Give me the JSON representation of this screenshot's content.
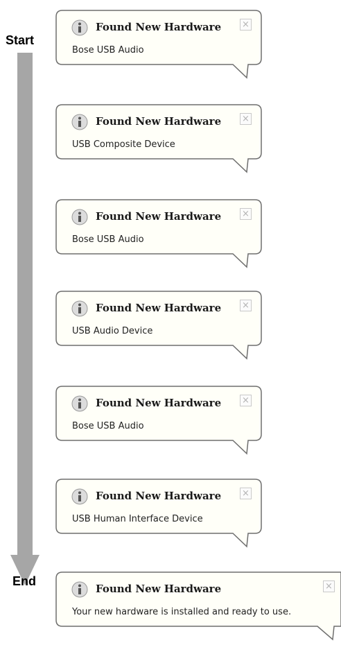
{
  "flow": {
    "start_label": "Start",
    "end_label": "End"
  },
  "notifications": [
    {
      "title": "Found New Hardware",
      "message": "Bose USB Audio",
      "close": "×"
    },
    {
      "title": "Found New Hardware",
      "message": "USB Composite Device",
      "close": "×"
    },
    {
      "title": "Found New Hardware",
      "message": "Bose USB Audio",
      "close": "×"
    },
    {
      "title": "Found New Hardware",
      "message": "USB Audio Device",
      "close": "×"
    },
    {
      "title": "Found New Hardware",
      "message": "Bose USB Audio",
      "close": "×"
    },
    {
      "title": "Found New Hardware",
      "message": "USB Human Interface Device",
      "close": "×"
    },
    {
      "title": "Found New Hardware",
      "message": "Your new hardware is installed and ready to use.",
      "close": "×"
    }
  ],
  "colors": {
    "arrow": "#a6a6a6",
    "balloon_border": "#6e6e6e",
    "balloon_fill": "#fffff8"
  },
  "icons": {
    "notification": "info-icon",
    "close": "close-icon"
  }
}
